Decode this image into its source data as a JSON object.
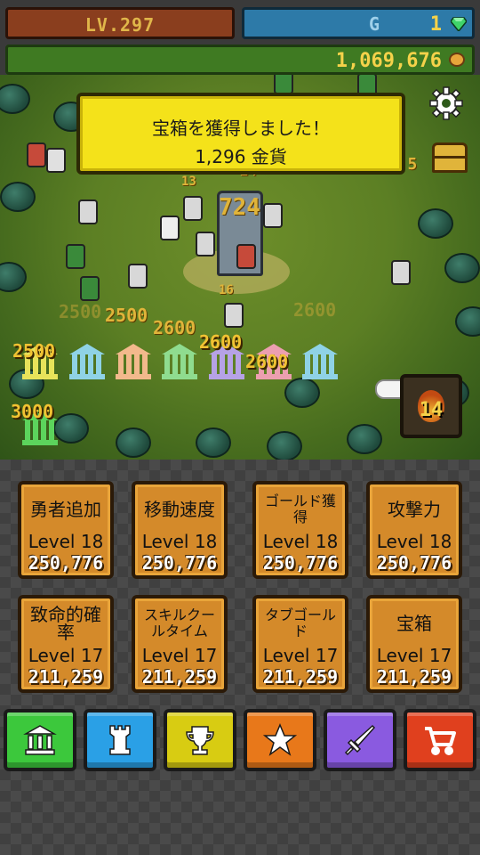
{
  "header": {
    "level": "LV.297",
    "gem_label": "G",
    "gem_count": "1",
    "gold": "1,069,676"
  },
  "toast": {
    "line1": "宝箱を獲得しました！",
    "line2": "1,296 金貨"
  },
  "battle": {
    "damage_numbers": [
      "13",
      "24",
      "724",
      "16",
      "2500",
      "2500",
      "2600",
      "2600",
      "2600",
      "25.5"
    ],
    "temples": [
      {
        "label": "2500",
        "color": "#e7e35a"
      },
      {
        "label": "",
        "color": "#8fd2e6"
      },
      {
        "label": "",
        "color": "#f2b98c"
      },
      {
        "label": "",
        "color": "#8fdc8f"
      },
      {
        "label": "2600",
        "color": "#b6a2e6"
      },
      {
        "label": "2600",
        "color": "#ec9fb0"
      },
      {
        "label": "",
        "color": "#8fd2e6"
      }
    ],
    "extra_temple": {
      "label": "3000",
      "color": "#5cd45c"
    },
    "skill_count": "14"
  },
  "upgrades": [
    {
      "name": "勇者追加",
      "level": "Level 18",
      "cost": "250,776"
    },
    {
      "name": "移動速度",
      "level": "Level 18",
      "cost": "250,776"
    },
    {
      "name": "ゴールド獲得",
      "level": "Level 18",
      "cost": "250,776"
    },
    {
      "name": "攻撃力",
      "level": "Level 18",
      "cost": "250,776"
    },
    {
      "name": "致命的確率",
      "level": "Level 17",
      "cost": "211,259"
    },
    {
      "name": "スキルクールタイム",
      "level": "Level 17",
      "cost": "211,259"
    },
    {
      "name": "タブゴールド",
      "level": "Level 17",
      "cost": "211,259"
    },
    {
      "name": "宝箱",
      "level": "Level 17",
      "cost": "211,259"
    }
  ],
  "nav": [
    {
      "icon": "temple-icon",
      "color": "#3cc83c"
    },
    {
      "icon": "tower-icon",
      "color": "#2aa0e6"
    },
    {
      "icon": "trophy-icon",
      "color": "#d8cc12"
    },
    {
      "icon": "star-icon",
      "color": "#e8781a"
    },
    {
      "icon": "sword-icon",
      "color": "#8a5ae0"
    },
    {
      "icon": "cart-icon",
      "color": "#e0401e"
    }
  ]
}
